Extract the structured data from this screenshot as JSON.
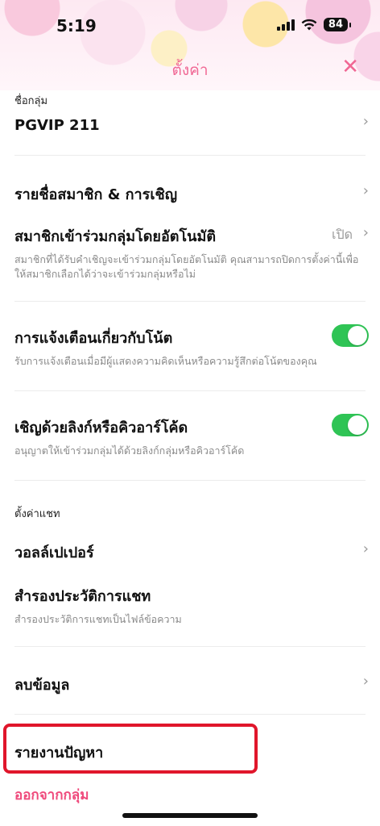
{
  "status_bar": {
    "time": "5:19",
    "battery": "84"
  },
  "nav": {
    "title": "ตั้งค่า",
    "close_label": "✕"
  },
  "group_name": {
    "label": "ชื่อกลุ่ม",
    "value": "PGVIP 211"
  },
  "members": {
    "title": "รายชื่อสมาชิก & การเชิญ"
  },
  "auto_join": {
    "title": "สมาชิกเข้าร่วมกลุ่มโดยอัตโนมัติ",
    "value": "เปิด",
    "description": "สมาชิกที่ได้รับคำเชิญจะเข้าร่วมกลุ่มโดยอัตโนมัติ คุณสามารถปิดการตั้งค่านี้เพื่อให้สมาชิกเลือกได้ว่าจะเข้าร่วมกลุ่มหรือไม่"
  },
  "note_notifications": {
    "title": "การแจ้งเตือนเกี่ยวกับโน้ต",
    "description": "รับการแจ้งเตือนเมื่อมีผู้แสดงความคิดเห็นหรือความรู้สึกต่อโน้ตของคุณ",
    "enabled": true
  },
  "invite_link": {
    "title": "เชิญด้วยลิงก์หรือคิวอาร์โค้ด",
    "description": "อนุญาตให้เข้าร่วมกลุ่มได้ด้วยลิงก์กลุ่มหรือคิวอาร์โค้ด",
    "enabled": true
  },
  "chat_settings": {
    "section_label": "ตั้งค่าแชท"
  },
  "wallpaper": {
    "title": "วอลล์เปเปอร์"
  },
  "backup": {
    "title": "สำรองประวัติการแชท",
    "description": "สำรองประวัติการแชทเป็นไฟล์ข้อความ"
  },
  "delete_data": {
    "title": "ลบข้อมูล"
  },
  "report": {
    "title": "รายงานปัญหา"
  },
  "leave": {
    "title": "ออกจากกลุ่ม"
  },
  "colors": {
    "accent": "#f06794",
    "toggle_on": "#2fc455",
    "highlight": "#e0162b"
  }
}
